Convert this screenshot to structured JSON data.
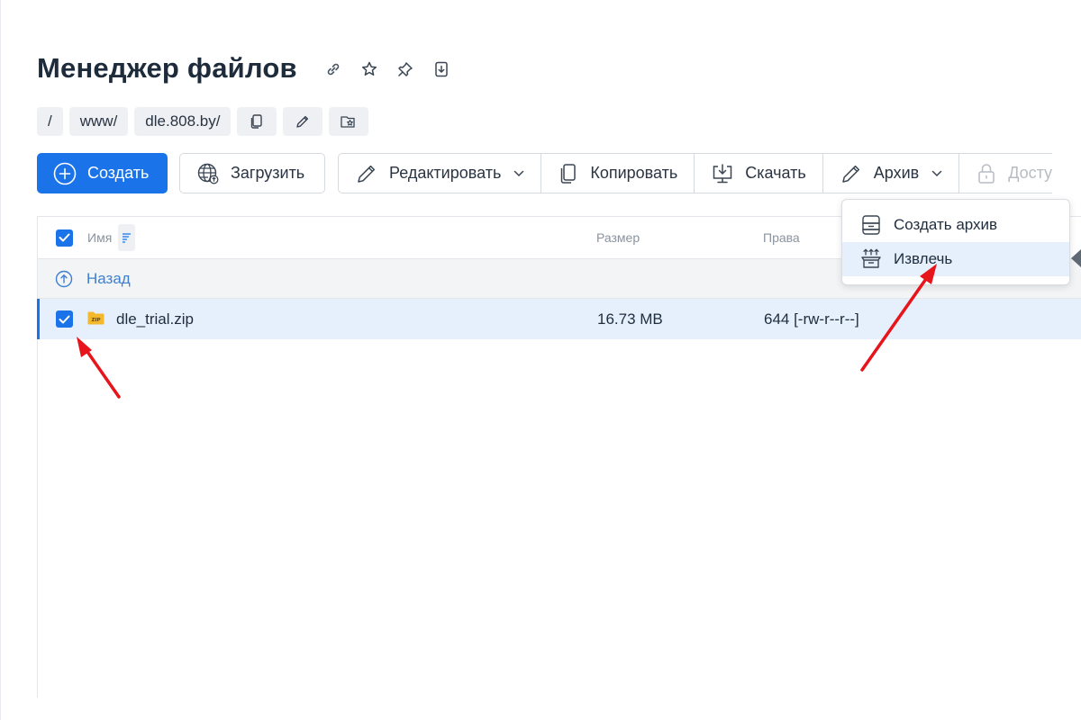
{
  "page": {
    "title": "Менеджер файлов"
  },
  "title_icons": [
    "link-icon",
    "star-icon",
    "pin-icon",
    "download-file-icon"
  ],
  "breadcrumb": {
    "root": "/",
    "items": [
      "www/",
      "dle.808.by/"
    ],
    "actions": [
      "copy-path-icon",
      "edit-path-icon",
      "favorite-path-icon"
    ]
  },
  "toolbar": {
    "create": "Создать",
    "upload": "Загрузить",
    "edit": "Редактировать",
    "copy": "Копировать",
    "download": "Скачать",
    "archive": "Архив",
    "access": "Досту"
  },
  "table": {
    "columns": {
      "name": "Имя",
      "size": "Размер",
      "perms": "Права"
    },
    "back_label": "Назад",
    "rows": [
      {
        "name": "dle_trial.zip",
        "size": "16.73 MB",
        "perms": "644 [-rw-r--r--]",
        "selected": true
      }
    ]
  },
  "archive_menu": {
    "items": [
      {
        "label": "Создать архив",
        "icon": "archive-box-icon",
        "active": false
      },
      {
        "label": "Извлечь",
        "icon": "extract-icon",
        "active": true
      }
    ]
  },
  "colors": {
    "accent": "#1a73e8",
    "annotation": "#e8141b",
    "selected_row": "#e6effc"
  }
}
